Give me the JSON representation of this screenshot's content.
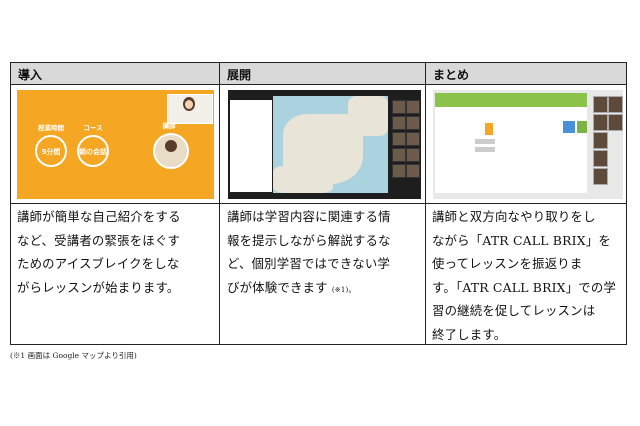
{
  "headers": [
    "導入",
    "展開",
    "まとめ"
  ],
  "screenshot1": {
    "label_time": "授業時間",
    "label_course": "コース",
    "label_teacher": "講師",
    "value_time": "5分間",
    "value_course": "朝の会話"
  },
  "descriptions": [
    [
      "講師が簡単な自己紹介をする",
      "など、受講者の緊張をほぐす",
      "ためのアイスブレイクをしな",
      "がらレッスンが始まります。"
    ],
    [
      "講師は学習内容に関連する情",
      "報を提示しながら解説するな",
      "ど、個別学習ではできない学",
      "びが体験できます"
    ],
    [
      "講師と双方向なやり取りをし",
      "ながら「ATR CALL BRIX」を",
      "使ってレッスンを振返りま",
      "す。「ATR CALL BRIX」での学",
      "習の継続を促してレッスンは",
      "終了します。"
    ]
  ],
  "desc2_note": "(※1)。",
  "footnote": "(※1 画面は Google マップより引用)",
  "colors": {
    "header_bg": "#d9d9d9",
    "orange": "#f5a623",
    "green": "#8bc34a"
  }
}
